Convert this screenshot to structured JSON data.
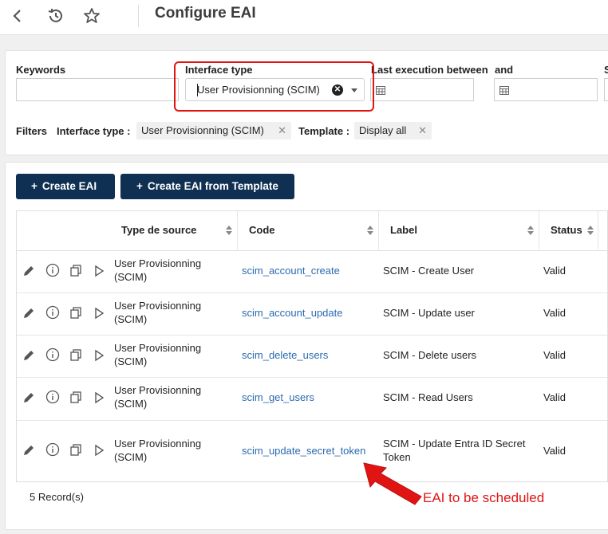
{
  "header": {
    "title": "Configure EAI",
    "icons": [
      "back-icon",
      "history-icon",
      "star-icon"
    ]
  },
  "filters": {
    "keywords_label": "Keywords",
    "keywords_value": "",
    "interface_type_label": "Interface type",
    "interface_type_value": "User Provisionning (SCIM)",
    "last_execution_label": "Last execution between",
    "and_label": "and",
    "truncated_label": "S",
    "active_filters_label": "Filters",
    "chips": [
      {
        "key": "Interface type :",
        "value": "User Provisionning (SCIM)"
      },
      {
        "key": "Template :",
        "value": "Display all"
      }
    ]
  },
  "actions": {
    "create_label": "Create EAI",
    "create_from_template_label": "Create EAI from Template"
  },
  "table": {
    "columns": [
      "Type de source",
      "Code",
      "Label",
      "Status"
    ],
    "rows": [
      {
        "source_line1": "User Provisionning",
        "source_line2": "(SCIM)",
        "code": "scim_account_create",
        "label_line1": "SCIM - Create User",
        "label_line2": "",
        "status": "Valid"
      },
      {
        "source_line1": "User Provisionning",
        "source_line2": "(SCIM)",
        "code": "scim_account_update",
        "label_line1": "SCIM - Update user",
        "label_line2": "",
        "status": "Valid"
      },
      {
        "source_line1": "User Provisionning",
        "source_line2": "(SCIM)",
        "code": "scim_delete_users",
        "label_line1": "SCIM - Delete users",
        "label_line2": "",
        "status": "Valid"
      },
      {
        "source_line1": "User Provisionning",
        "source_line2": "(SCIM)",
        "code": "scim_get_users",
        "label_line1": "SCIM - Read Users",
        "label_line2": "",
        "status": "Valid"
      },
      {
        "source_line1": "User Provisionning",
        "source_line2": "(SCIM)",
        "code": "scim_update_secret_token",
        "label_line1": "SCIM - Update Entra ID Secret",
        "label_line2": "Token",
        "status": "Valid"
      }
    ],
    "record_count": "5 Record(s)"
  },
  "annotation": {
    "text": "EAI to be scheduled",
    "color": "#e11414"
  },
  "colors": {
    "primary_button": "#0f2f53",
    "link": "#2a6bb0",
    "highlight": "#e11414"
  }
}
